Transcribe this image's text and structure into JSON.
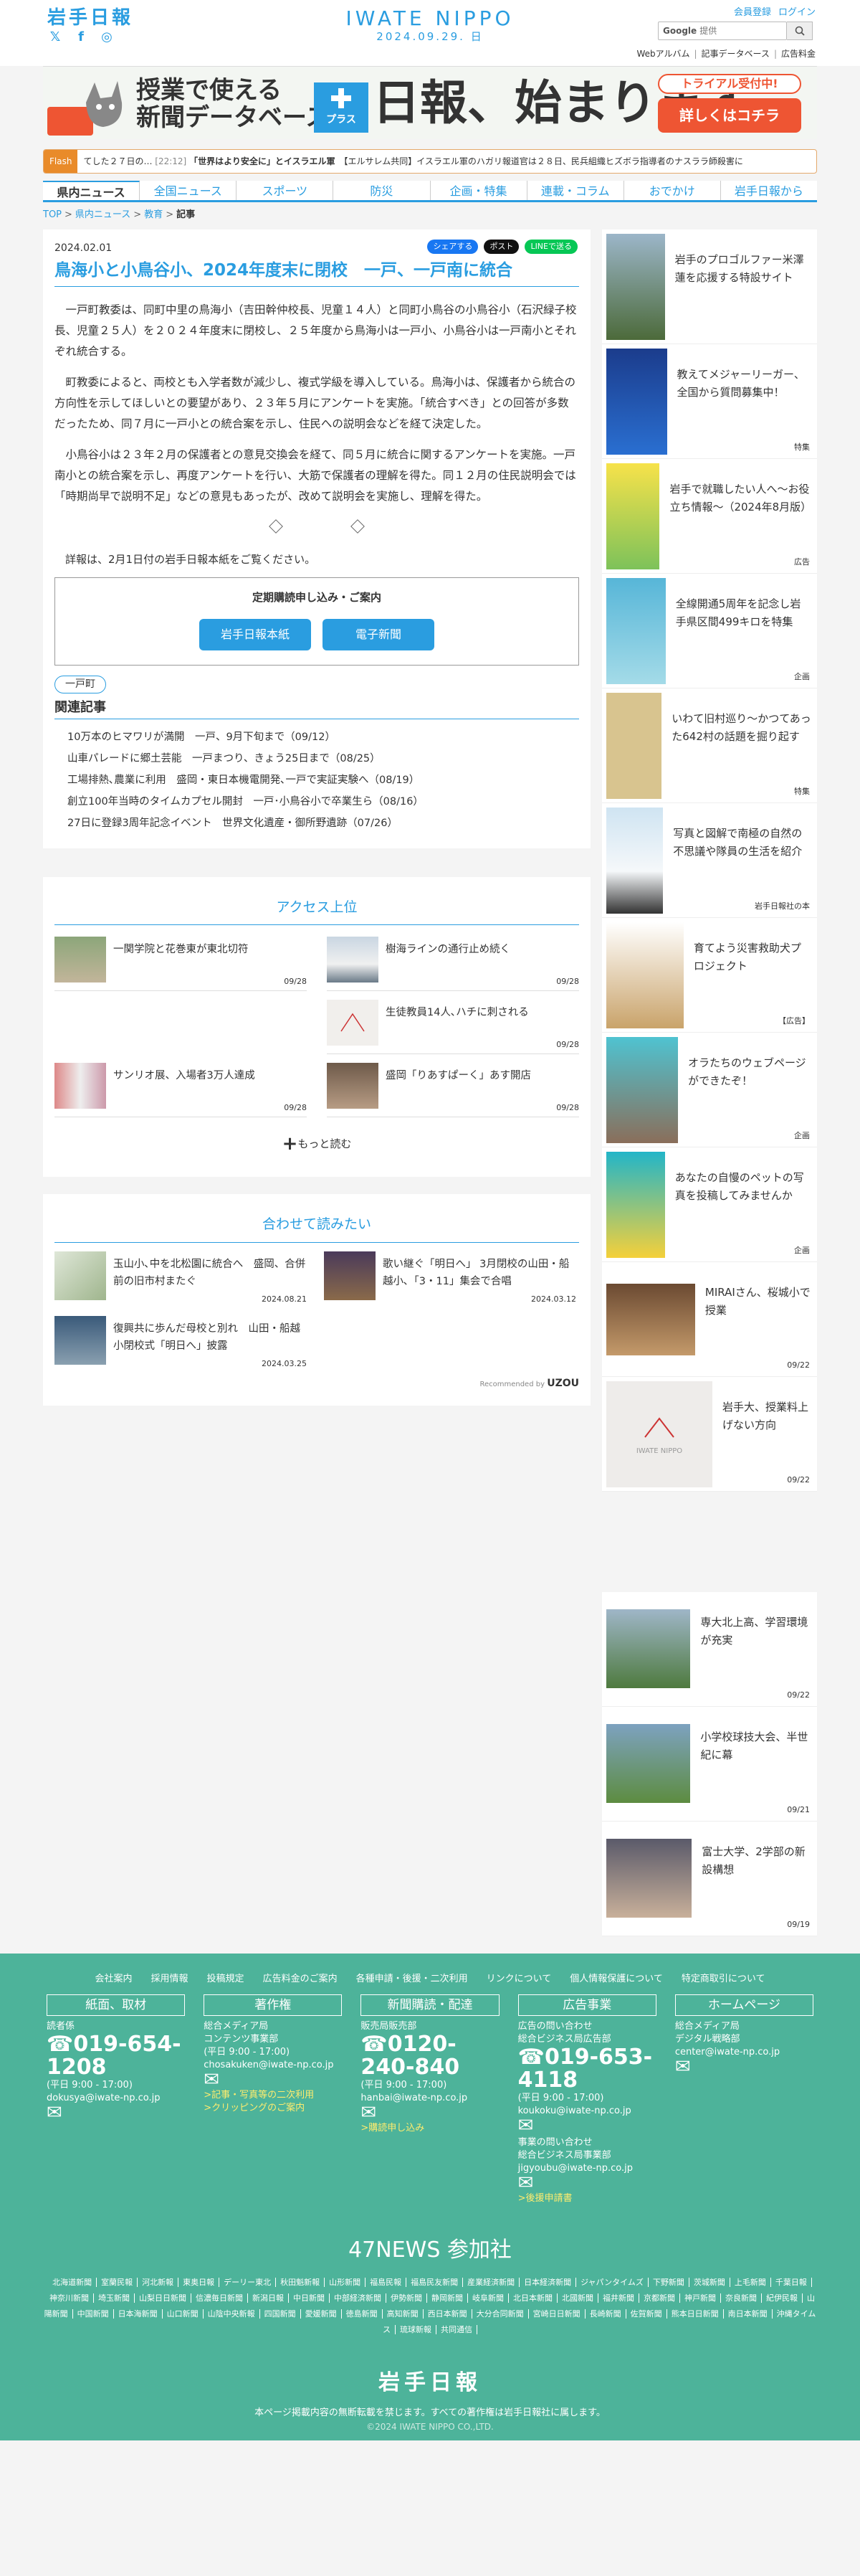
{
  "header": {
    "logo_text": "岩手日報",
    "site_logo": "IWATE NIPPO",
    "date": "2024.09.29. 日",
    "register": "会員登録",
    "login": "ログイン",
    "search_brand": "Google",
    "search_placeholder": "提供",
    "search_button": "",
    "sublinks": [
      "Webアルバム",
      "記事データベース",
      "広告料金"
    ]
  },
  "banner": {
    "line1": "授業で使える",
    "line2": "新聞データベース",
    "plus": "プラス",
    "nippo": "日報、始まります。",
    "trial": "トライアル受付中!",
    "cta": "詳しくはコチラ"
  },
  "flash": {
    "label": "Flash",
    "text": "てした２７日の…",
    "time": "[22:12]",
    "highlight": "「世界はより安全に」とイスラエル軍",
    "text2": "【エルサレム共同】イスラエル軍のハガリ報道官は２８日、民兵組織ヒズボラ指導者のナスララ師殺害に"
  },
  "nav": [
    "県内ニュース",
    "全国ニュース",
    "スポーツ",
    "防災",
    "企画・特集",
    "連載・コラム",
    "おでかけ",
    "岩手日報から"
  ],
  "breadcrumb": [
    "TOP",
    "県内ニュース",
    "教育",
    "記事"
  ],
  "article": {
    "date": "2024.02.01",
    "share": [
      "シェアする",
      "ポスト",
      "LINEで送る"
    ],
    "title": "鳥海小と小鳥谷小、2024年度末に閉校　一戸、一戸南に統合",
    "paras": [
      "一戸町教委は、同町中里の鳥海小（吉田幹仲校長、児童１４人）と同町小鳥谷の小鳥谷小（石沢緑子校長、児童２５人）を２０２４年度末に閉校し、２５年度から鳥海小は一戸小、小鳥谷小は一戸南小とそれぞれ統合する。",
      "町教委によると、両校とも入学者数が減少し、複式学級を導入している。鳥海小は、保護者から統合の方向性を示してほしいとの要望があり、２３年５月にアンケートを実施。「統合すべき」との回答が多数だったため、同７月に一戸小との統合案を示し、住民への説明会などを経て決定した。",
      "小鳥谷小は２３年２月の保護者との意見交換会を経て、同５月に統合に関するアンケートを実施。一戸南小との統合案を示し、再度アンケートを行い、大筋で保護者の理解を得た。同１２月の住民説明会では「時期尚早で説明不足」などの意見もあったが、改めて説明会を実施し、理解を得た。"
    ],
    "note": "詳報は、2月1日付の岩手日報本紙をご覧ください。",
    "subscribe": {
      "title": "定期購読申し込み・ご案内",
      "buttons": [
        "岩手日報本紙",
        "電子新聞"
      ]
    },
    "tag": "一戸町",
    "related_title": "関連記事",
    "related": [
      "10万本のヒマワリが満開　一戸、9月下旬まで（09/12）",
      "山車パレードに郷土芸能　一戸まつり、きょう25日まで（08/25）",
      "工場排熱､農業に利用　盛岡・東日本機電開発､一戸で実証実験へ（08/19）",
      "創立100年当時のタイムカプセル開封　一戸･小鳥谷小で卒業生ら（08/16）",
      "27日に登録3周年記念イベント　世界文化遺産・御所野遺跡（07/26）"
    ]
  },
  "access": {
    "title": "アクセス上位",
    "items": [
      {
        "title": "一関学院と花巻東が東北切符",
        "date": "09/28"
      },
      {
        "title": "樹海ラインの通行止め続く",
        "date": "09/28"
      },
      {
        "title": "",
        "date": ""
      },
      {
        "title": "生徒教員14人､ハチに刺される",
        "date": "09/28"
      },
      {
        "title": "サンリオ展、入場者3万人達成",
        "date": "09/28"
      },
      {
        "title": "盛岡「りあすぱーく」あす開店",
        "date": "09/28"
      }
    ],
    "more": "もっと読む"
  },
  "together": {
    "title": "合わせて読みたい",
    "items": [
      {
        "title": "玉山小､中を北松園に統合へ　盛岡、合併前の旧市村またぐ",
        "date": "2024.08.21"
      },
      {
        "title": "歌い継ぐ「明日へ」 3月閉校の山田・船越小､「3・11」集会で合唱",
        "date": "2024.03.12"
      },
      {
        "title": "復興共に歩んだ母校と別れ　山田・船越小閉校式「明日へ」披露",
        "date": "2024.03.25"
      }
    ],
    "recommended": "Recommended by",
    "uzou": "UZOU"
  },
  "sidebar": [
    {
      "text": "岩手のプロゴルファー米澤蓮を応援する特設サイト",
      "label": "",
      "img": "Ren"
    },
    {
      "text": "教えてメジャーリーガー、全国から質問募集中！",
      "label": "特集",
      "img": "教えてメジャーリーガー"
    },
    {
      "text": "岩手で就職したい人へ〜お役立ち情報〜（2024年8月版）",
      "label": "広告",
      "img": "イワテでシゴトする"
    },
    {
      "text": "全線開通5周年を記念し岩手県区間499キロを特集",
      "label": "企画",
      "img": "潮風"
    },
    {
      "text": "いわて旧村巡り〜かつてあった642村の話題を掘り起す",
      "label": "特集",
      "img": "いわて旧村巡り"
    },
    {
      "text": "写真と図解で南極の自然の不思議や隊員の生活を紹介",
      "label": "岩手日報社の本",
      "img": "南極探査500日"
    },
    {
      "text": "育てよう災害救助犬プロジェクト",
      "label": "【広告】",
      "img": "災害救助犬"
    },
    {
      "text": "オラたちのウェブページができたぞ！",
      "label": "企画",
      "img": "cat"
    },
    {
      "text": "あなたの自慢のペットの写真を投稿してみませんか",
      "label": "企画",
      "img": "わがまのイワニャン"
    },
    {
      "text": "MIRAIさん、桜城小で授業",
      "label": "09/22",
      "img": ""
    },
    {
      "text": "岩手大、授業料上げない方向",
      "label": "09/22",
      "img": "IWATE NIPPO"
    },
    {
      "text": "専大北上高、学習環境が充実",
      "label": "09/22",
      "img": ""
    },
    {
      "text": "小学校球技大会、半世紀に幕",
      "label": "09/21",
      "img": ""
    },
    {
      "text": "富士大学、2学部の新設構想",
      "label": "09/19",
      "img": ""
    }
  ],
  "footer": {
    "links": [
      "会社案内",
      "採用情報",
      "投稿規定",
      "広告料金のご案内",
      "各種申請・後援・二次利用",
      "リンクについて",
      "個人情報保護について",
      "特定商取引について"
    ],
    "cols": [
      {
        "head": "紙面、取材",
        "l1": "読者係",
        "phone": "019-654-1208",
        "hours": "(平日 9:00 - 17:00)",
        "mail": "dokusya@iwate-np.co.jp",
        "extra": ""
      },
      {
        "head": "著作権",
        "l1": "総合メディア局",
        "l2": "コンテンツ事業部",
        "hours": "(平日 9:00 - 17:00)",
        "mail": "chosakuken@iwate-np.co.jp",
        "y1": ">記事・写真等の二次利用",
        "y2": ">クリッピングのご案内"
      },
      {
        "head": "新聞購読・配達",
        "l1": "販売局販売部",
        "phone": "0120-240-840",
        "hours": "(平日 9:00 - 17:00)",
        "mail": "hanbai@iwate-np.co.jp",
        "y1": ">購読申し込み"
      },
      {
        "head": "広告事業",
        "l1": "広告の問い合わせ",
        "l2": "総合ビジネス局広告部",
        "phone": "019-653-4118",
        "hours": "(平日 9:00 - 17:00)",
        "mail": "koukoku@iwate-np.co.jp",
        "l3": "事業の問い合わせ",
        "l4": "総合ビジネス局事業部",
        "mail2": "jigyoubu@iwate-np.co.jp",
        "y1": ">後援申請書"
      },
      {
        "head": "ホームページ",
        "l1": "総合メディア局",
        "l2": "デジタル戦略部",
        "mail": "center@iwate-np.co.jp"
      }
    ],
    "n47": "47NEWS 参加社",
    "papers": [
      "北海道新聞",
      "室蘭民報",
      "河北新報",
      "東奥日報",
      "デーリー東北",
      "秋田魁新報",
      "山形新聞",
      "福島民報",
      "福島民友新聞",
      "産業経済新聞",
      "日本経済新聞",
      "ジャパンタイムズ",
      "下野新聞",
      "茨城新聞",
      "上毛新聞",
      "千葉日報",
      "神奈川新聞",
      "埼玉新聞",
      "山梨日日新聞",
      "信濃毎日新聞",
      "新潟日報",
      "中日新聞",
      "中部経済新聞",
      "伊勢新聞",
      "静岡新聞",
      "岐阜新聞",
      "北日本新聞",
      "北國新聞",
      "福井新聞",
      "京都新聞",
      "神戸新聞",
      "奈良新聞",
      "紀伊民報",
      "山陽新聞",
      "中国新聞",
      "日本海新聞",
      "山口新聞",
      "山陰中央新報",
      "四国新聞",
      "愛媛新聞",
      "徳島新聞",
      "高知新聞",
      "西日本新聞",
      "大分合同新聞",
      "宮崎日日新聞",
      "長崎新聞",
      "佐賀新聞",
      "熊本日日新聞",
      "南日本新聞",
      "沖縄タイムス",
      "琉球新報",
      "共同通信"
    ],
    "logo": "岩手日報",
    "copy": "本ページ掲載内容の無断転載を禁じます。すべての著作権は岩手日報社に属します。",
    "cr": "©2024 IWATE NIPPO CO.,LTD."
  }
}
